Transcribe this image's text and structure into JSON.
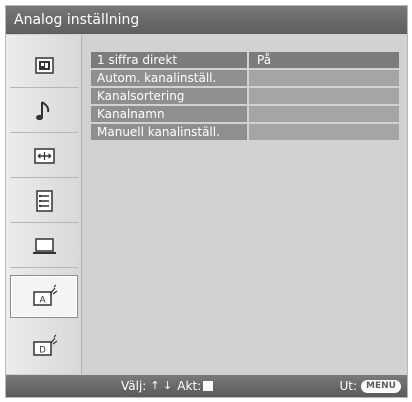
{
  "title": "Analog inställning",
  "sidebar": {
    "items": [
      {
        "icon": "picture-icon"
      },
      {
        "icon": "music-note-icon"
      },
      {
        "icon": "screen-icon"
      },
      {
        "icon": "setup-list-icon"
      },
      {
        "icon": "pc-icon"
      },
      {
        "icon": "analog-setup-icon",
        "active": true
      },
      {
        "icon": "digital-setup-icon"
      }
    ]
  },
  "menu": {
    "items": [
      {
        "label": "1 siffra direkt",
        "value": "På"
      },
      {
        "label": "Autom. kanalinställ.",
        "value": ""
      },
      {
        "label": "Kanalsortering",
        "value": ""
      },
      {
        "label": "Kanalnamn",
        "value": ""
      },
      {
        "label": "Manuell kanalinställ.",
        "value": ""
      }
    ]
  },
  "footer": {
    "select_label": "Välj:",
    "select_arrows": "↑ ↓",
    "action_label": "Akt:",
    "exit_label": "Ut:",
    "menu_button": "MENU"
  }
}
